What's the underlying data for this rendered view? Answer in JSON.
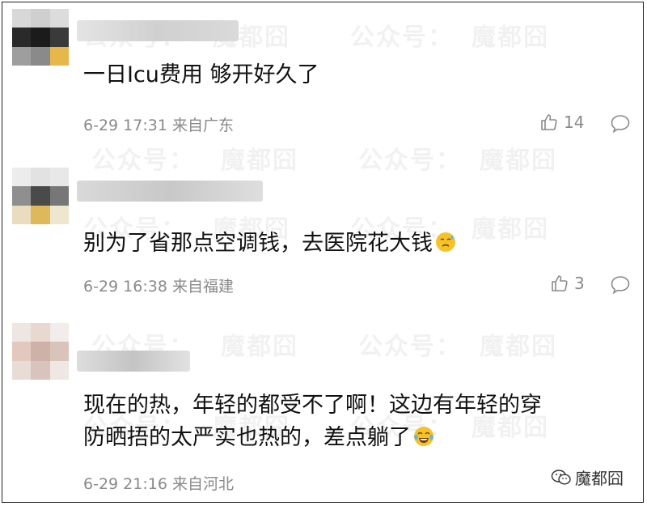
{
  "watermark": {
    "account": "公众号：",
    "brand": "魔都囧"
  },
  "comments": [
    {
      "text_lines": [
        "一日Icu费用 够开好久了"
      ],
      "date_time": "6-29 17:31",
      "location": "来自广东",
      "likes": "14",
      "avatar_colors": [
        "#d8d8d8",
        "#cfcfcf",
        "#dcdcdc",
        "#2a2a2a",
        "#1b1b1b",
        "#3a3a3a",
        "#9e9e9e",
        "#8a8a8a",
        "#e6b84a"
      ],
      "username_colors": [
        "#e4e4e4",
        "#d0d0d0",
        "#dadada"
      ]
    },
    {
      "text_lines": [
        "别为了省那点空调钱，去医院花大钱"
      ],
      "date_time": "6-29 16:38",
      "location": "来自福建",
      "likes": "3",
      "avatar_colors": [
        "#ececec",
        "#e2e2e2",
        "#e8e8e8",
        "#8f8f8f",
        "#4a4a4a",
        "#777777",
        "#e9dcbf",
        "#e0b85c",
        "#efe6d0"
      ],
      "username_colors": [
        "#d9d9d9",
        "#c8c8c8",
        "#dedede"
      ]
    },
    {
      "text_lines": [
        "现在的热，年轻的都受不了啊！这边有年轻的穿",
        "防晒捂的太严实也热的，差点躺了"
      ],
      "date_time": "6-29 21:16",
      "location": "来自河北",
      "likes": "",
      "avatar_colors": [
        "#eee6e2",
        "#e8d8d0",
        "#f2ecea",
        "#e3c9bd",
        "#cdb2a8",
        "#d9c3ba",
        "#e8dcd6",
        "#d8c4bc",
        "#efe7e3"
      ],
      "username_colors": [
        "#dddddd",
        "#c4c4c4",
        "#e2e2e2"
      ]
    }
  ],
  "icons": {
    "like": "thumbs-up-icon",
    "reply": "speech-bubble-icon",
    "emoji_sweat": "sweat-face-emoji",
    "emoji_laugh": "tears-of-joy-emoji",
    "brand": "wechat-icon"
  },
  "colors": {
    "meta_gray": "#8a8a8a",
    "emoji_yellow": "#f5c327"
  }
}
